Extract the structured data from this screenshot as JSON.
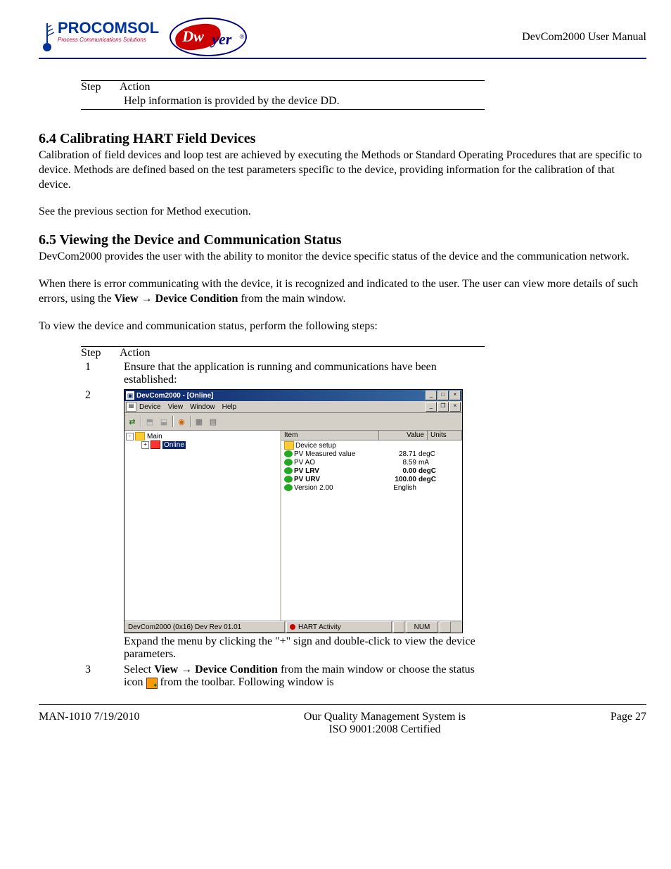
{
  "header": {
    "logo_brand_main": "ProComSol",
    "logo_brand_sub": "Process Communications Solutions",
    "logo_dwyer_d": "Dw",
    "logo_dwyer_tail": "yer",
    "logo_dwyer_r": "®",
    "doc_title": "DevCom2000 User Manual"
  },
  "top_table": {
    "col_step": "Step",
    "col_action": "Action",
    "row_text": "Help information is provided by the device DD."
  },
  "section_64": {
    "heading": "6.4   Calibrating HART Field Devices",
    "p1": "Calibration of field devices and loop test are achieved by executing the Methods or Standard Operating Procedures that are specific to device.  Methods are defined based on the test parameters specific to the device, providing information for the calibration of that device.",
    "p2": "See the previous section for Method execution."
  },
  "section_65": {
    "heading": "6.5   Viewing the Device and Communication Status",
    "p1": "DevCom2000 provides the user with the ability to monitor the device specific status of the device and the communication network.",
    "p2a": "When there is error communicating with the device, it is recognized and indicated to the user. The user can view more details of such errors, using the ",
    "p2b": "View → Device Condition",
    "p2c": " from the main window.",
    "p3": "To view the device and communication status, perform the following steps:"
  },
  "steps_table": {
    "col_step": "Step",
    "col_action": "Action",
    "rows": [
      {
        "num": "1",
        "text": "Ensure that the application is running and communications have been established:"
      },
      {
        "num": "2",
        "text_after": "Expand the menu by clicking the \"+\" sign and double-click to view the device parameters."
      },
      {
        "num": "3",
        "t1": "Select ",
        "t2": "View → Device Condition",
        "t3": " from the main window or choose the status icon ",
        "t4": " from the toolbar. Following window is"
      }
    ]
  },
  "app": {
    "title": "DevCom2000 - [Online]",
    "menu": {
      "device": "Device",
      "view": "View",
      "window": "Window",
      "help": "Help"
    },
    "tree": {
      "root": "Main",
      "child": "Online"
    },
    "list": {
      "headers": {
        "item": "Item",
        "value": "Value",
        "units": "Units"
      },
      "rows": [
        {
          "name": "Device setup",
          "val": "",
          "unit": "",
          "icon": "folder",
          "bold": false
        },
        {
          "name": "PV Measured value",
          "val": "28.71",
          "unit": "degC",
          "icon": "green",
          "bold": false
        },
        {
          "name": "PV AO",
          "val": "8.59",
          "unit": "mA",
          "icon": "green",
          "bold": false
        },
        {
          "name": "PV LRV",
          "val": "0.00",
          "unit": "degC",
          "icon": "green",
          "bold": true
        },
        {
          "name": "PV URV",
          "val": "100.00",
          "unit": "degC",
          "icon": "green",
          "bold": true
        },
        {
          "name": "Version 2.00",
          "val": "English",
          "unit": "",
          "icon": "green",
          "bold": false
        }
      ]
    },
    "status": {
      "left": "DevCom2000  (0x16) Dev Rev 01.01",
      "hart": "HART Activity",
      "num": "NUM"
    }
  },
  "footer": {
    "left": "MAN-1010 7/19/2010",
    "center1": "Our Quality Management System is",
    "center2": "ISO 9001:2008 Certified",
    "right": "Page 27"
  }
}
